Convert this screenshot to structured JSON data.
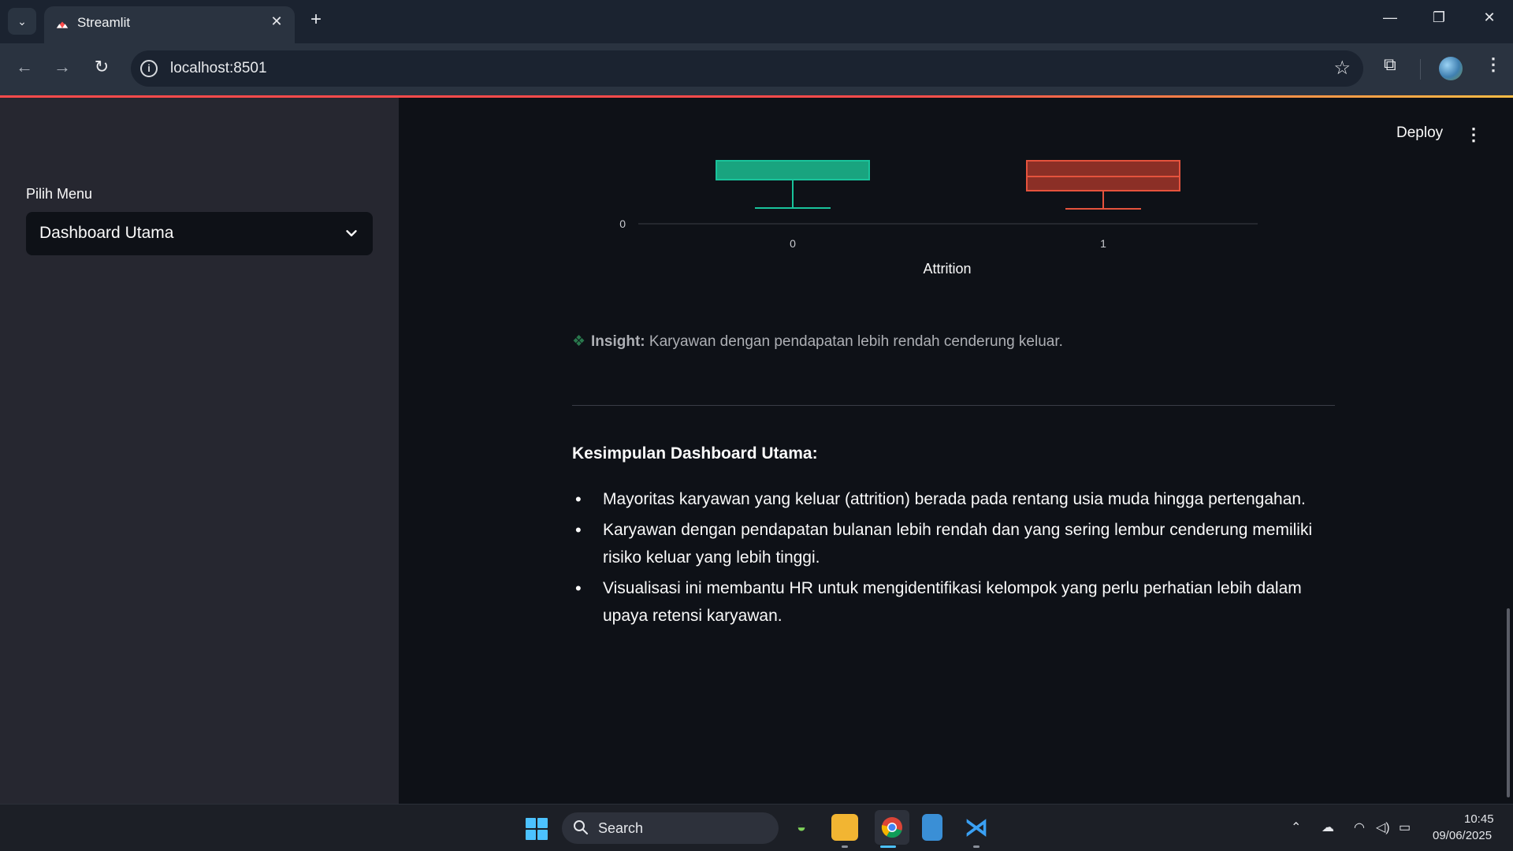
{
  "browser": {
    "tab_title": "Streamlit",
    "url": "localhost:8501"
  },
  "sidebar": {
    "menu_label": "Pilih Menu",
    "menu_selected": "Dashboard Utama"
  },
  "header": {
    "deploy_label": "Deploy"
  },
  "chart_data": {
    "type": "box",
    "xlabel": "Attrition",
    "categories": [
      "0",
      "1"
    ],
    "y_tick_visible": "0",
    "colors": [
      "#19c39b",
      "#e5533d"
    ]
  },
  "insight": {
    "label": "Insight:",
    "text": "Karyawan dengan pendapatan lebih rendah cenderung keluar."
  },
  "conclusion": {
    "title": "Kesimpulan Dashboard Utama:",
    "items": [
      "Mayoritas karyawan yang keluar (attrition) berada pada rentang usia muda hingga pertengahan.",
      "Karyawan dengan pendapatan bulanan lebih rendah dan yang sering lembur cenderung memiliki risiko keluar yang lebih tinggi.",
      "Visualisasi ini membantu HR untuk mengidentifikasi kelompok yang perlu perhatian lebih dalam upaya retensi karyawan."
    ]
  },
  "taskbar": {
    "search_placeholder": "Search",
    "time": "10:45",
    "date": "09/06/2025"
  }
}
